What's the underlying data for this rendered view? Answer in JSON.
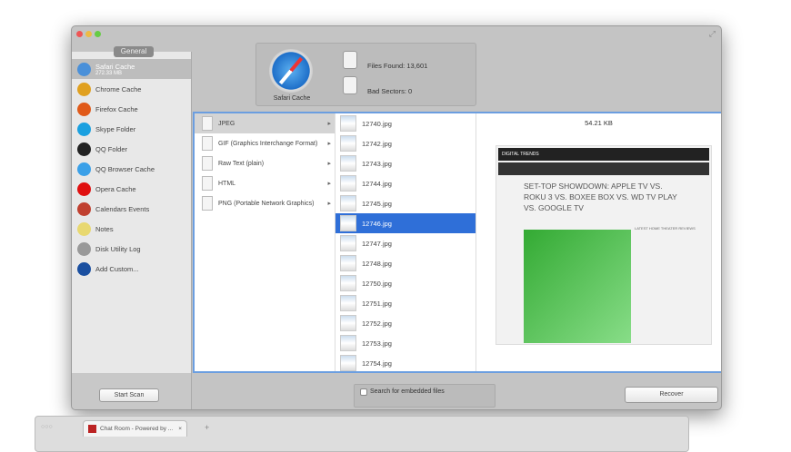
{
  "sidebar": {
    "tab": "General",
    "items": [
      {
        "label": "Safari Cache",
        "sub": "272.33 MB",
        "icon": "safari-icon",
        "color": "#4a90d9"
      },
      {
        "label": "Chrome Cache",
        "icon": "chrome-icon",
        "color": "#e0a020"
      },
      {
        "label": "Firefox Cache",
        "icon": "firefox-icon",
        "color": "#e05a1a"
      },
      {
        "label": "Skype Folder",
        "icon": "skype-icon",
        "color": "#1aa0e0"
      },
      {
        "label": "QQ Folder",
        "icon": "qq-icon",
        "color": "#222222"
      },
      {
        "label": "QQ Browser Cache",
        "icon": "qq-browser-icon",
        "color": "#3aa0e8"
      },
      {
        "label": "Opera Cache",
        "icon": "opera-icon",
        "color": "#e01010"
      },
      {
        "label": "Calendars Events",
        "icon": "calendar-icon",
        "color": "#c04030"
      },
      {
        "label": "Notes",
        "icon": "notes-icon",
        "color": "#e8d870"
      },
      {
        "label": "Disk Utility Log",
        "icon": "disk-utility-icon",
        "color": "#999999"
      },
      {
        "label": "Add Custom...",
        "icon": "help-icon",
        "color": "#1a4fa0"
      }
    ]
  },
  "header": {
    "source": "Safari Cache",
    "files_found": "Files Found:  13,601",
    "bad_sectors": "Bad Sectors:  0"
  },
  "types": [
    {
      "label": "JPEG"
    },
    {
      "label": "GIF (Graphics Interchange Format)"
    },
    {
      "label": "Raw Text (plain)"
    },
    {
      "label": "HTML"
    },
    {
      "label": "PNG (Portable Network Graphics)"
    }
  ],
  "files": [
    "12740.jpg",
    "12742.jpg",
    "12743.jpg",
    "12744.jpg",
    "12745.jpg",
    "12746.jpg",
    "12747.jpg",
    "12748.jpg",
    "12750.jpg",
    "12751.jpg",
    "12752.jpg",
    "12753.jpg",
    "12754.jpg"
  ],
  "selected_file": "12746.jpg",
  "preview": {
    "size": "54.21 KB",
    "site": "DIGITAL TRENDS",
    "headline": "SET-TOP SHOWDOWN: APPLE TV VS. ROKU 3 VS. BOXEE BOX VS. WD TV PLAY VS. GOOGLE TV",
    "sidebar_title": "LATEST HOME THEATER REVIEWS"
  },
  "buttons": {
    "start_scan": "Start Scan",
    "recover": "Recover",
    "embedded": "Search for embedded files"
  },
  "browser": {
    "tab": "Chat Room - Powered by ...",
    "new_tab": "+",
    "close": "×"
  }
}
